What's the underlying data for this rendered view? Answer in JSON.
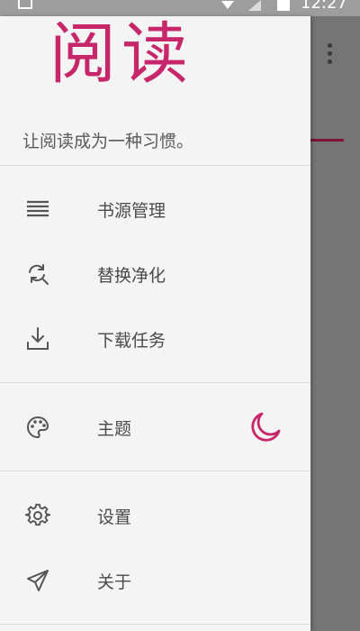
{
  "status_bar": {
    "time": "12:27"
  },
  "drawer": {
    "logo": "阅读",
    "slogan": "让阅读成为一种习惯。",
    "menu": {
      "sources": {
        "label": "书源管理",
        "icon": "list-icon"
      },
      "replace": {
        "label": "替换净化",
        "icon": "replace-icon"
      },
      "download": {
        "label": "下载任务",
        "icon": "download-icon"
      },
      "theme": {
        "label": "主题",
        "icon": "palette-icon",
        "toggle_icon": "moon-icon"
      },
      "settings": {
        "label": "设置",
        "icon": "gear-icon"
      },
      "about": {
        "label": "关于",
        "icon": "send-icon"
      }
    }
  },
  "colors": {
    "accent": "#c8266a",
    "drawer_bg": "#f4f4f4",
    "scrim": "#757575"
  }
}
